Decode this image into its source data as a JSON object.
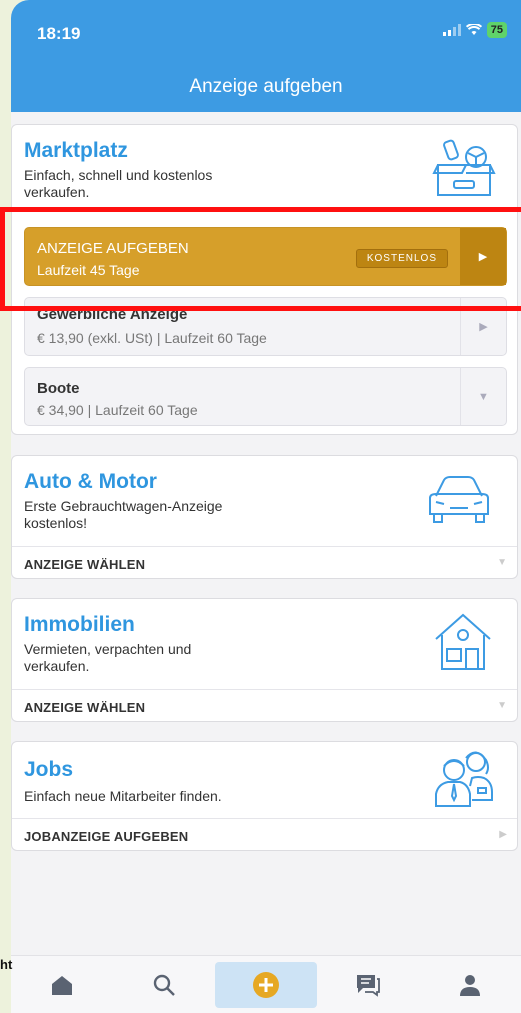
{
  "status": {
    "time": "18:19",
    "battery": "75"
  },
  "header": {
    "title": "Anzeige aufgeben"
  },
  "marktplatz": {
    "title": "Marktplatz",
    "subtitle_line1": "Einfach, schnell und kostenlos",
    "subtitle_line2": "verkaufen.",
    "options": [
      {
        "title": "ANZEIGE AUFGEBEN",
        "subtitle": "Laufzeit 45 Tage",
        "badge": "KOSTENLOS"
      },
      {
        "title": "Gewerbliche Anzeige",
        "subtitle": "€ 13,90 (exkl. USt) | Laufzeit 60 Tage"
      },
      {
        "title": "Boote",
        "subtitle": "€ 34,90 | Laufzeit 60 Tage"
      }
    ]
  },
  "auto": {
    "title": "Auto & Motor",
    "subtitle_line1": "Erste Gebrauchtwagen-Anzeige",
    "subtitle_line2": "kostenlos!",
    "action": "ANZEIGE WÄHLEN"
  },
  "immobilien": {
    "title": "Immobilien",
    "subtitle_line1": "Vermieten, verpachten und",
    "subtitle_line2": "verkaufen.",
    "action": "ANZEIGE WÄHLEN"
  },
  "jobs": {
    "title": "Jobs",
    "subtitle_line1": "Einfach neue Mitarbeiter finden.",
    "action": "JOBANZEIGE AUFGEBEN"
  },
  "cutoff_text": "ht",
  "tabbar": {
    "tabs": [
      "home-icon",
      "search-icon",
      "add-icon",
      "messages-icon",
      "profile-icon"
    ],
    "active_index": 2
  },
  "colors": {
    "brand": "#3d9be3",
    "accent": "#d69f2a",
    "highlight": "#ff1010"
  }
}
